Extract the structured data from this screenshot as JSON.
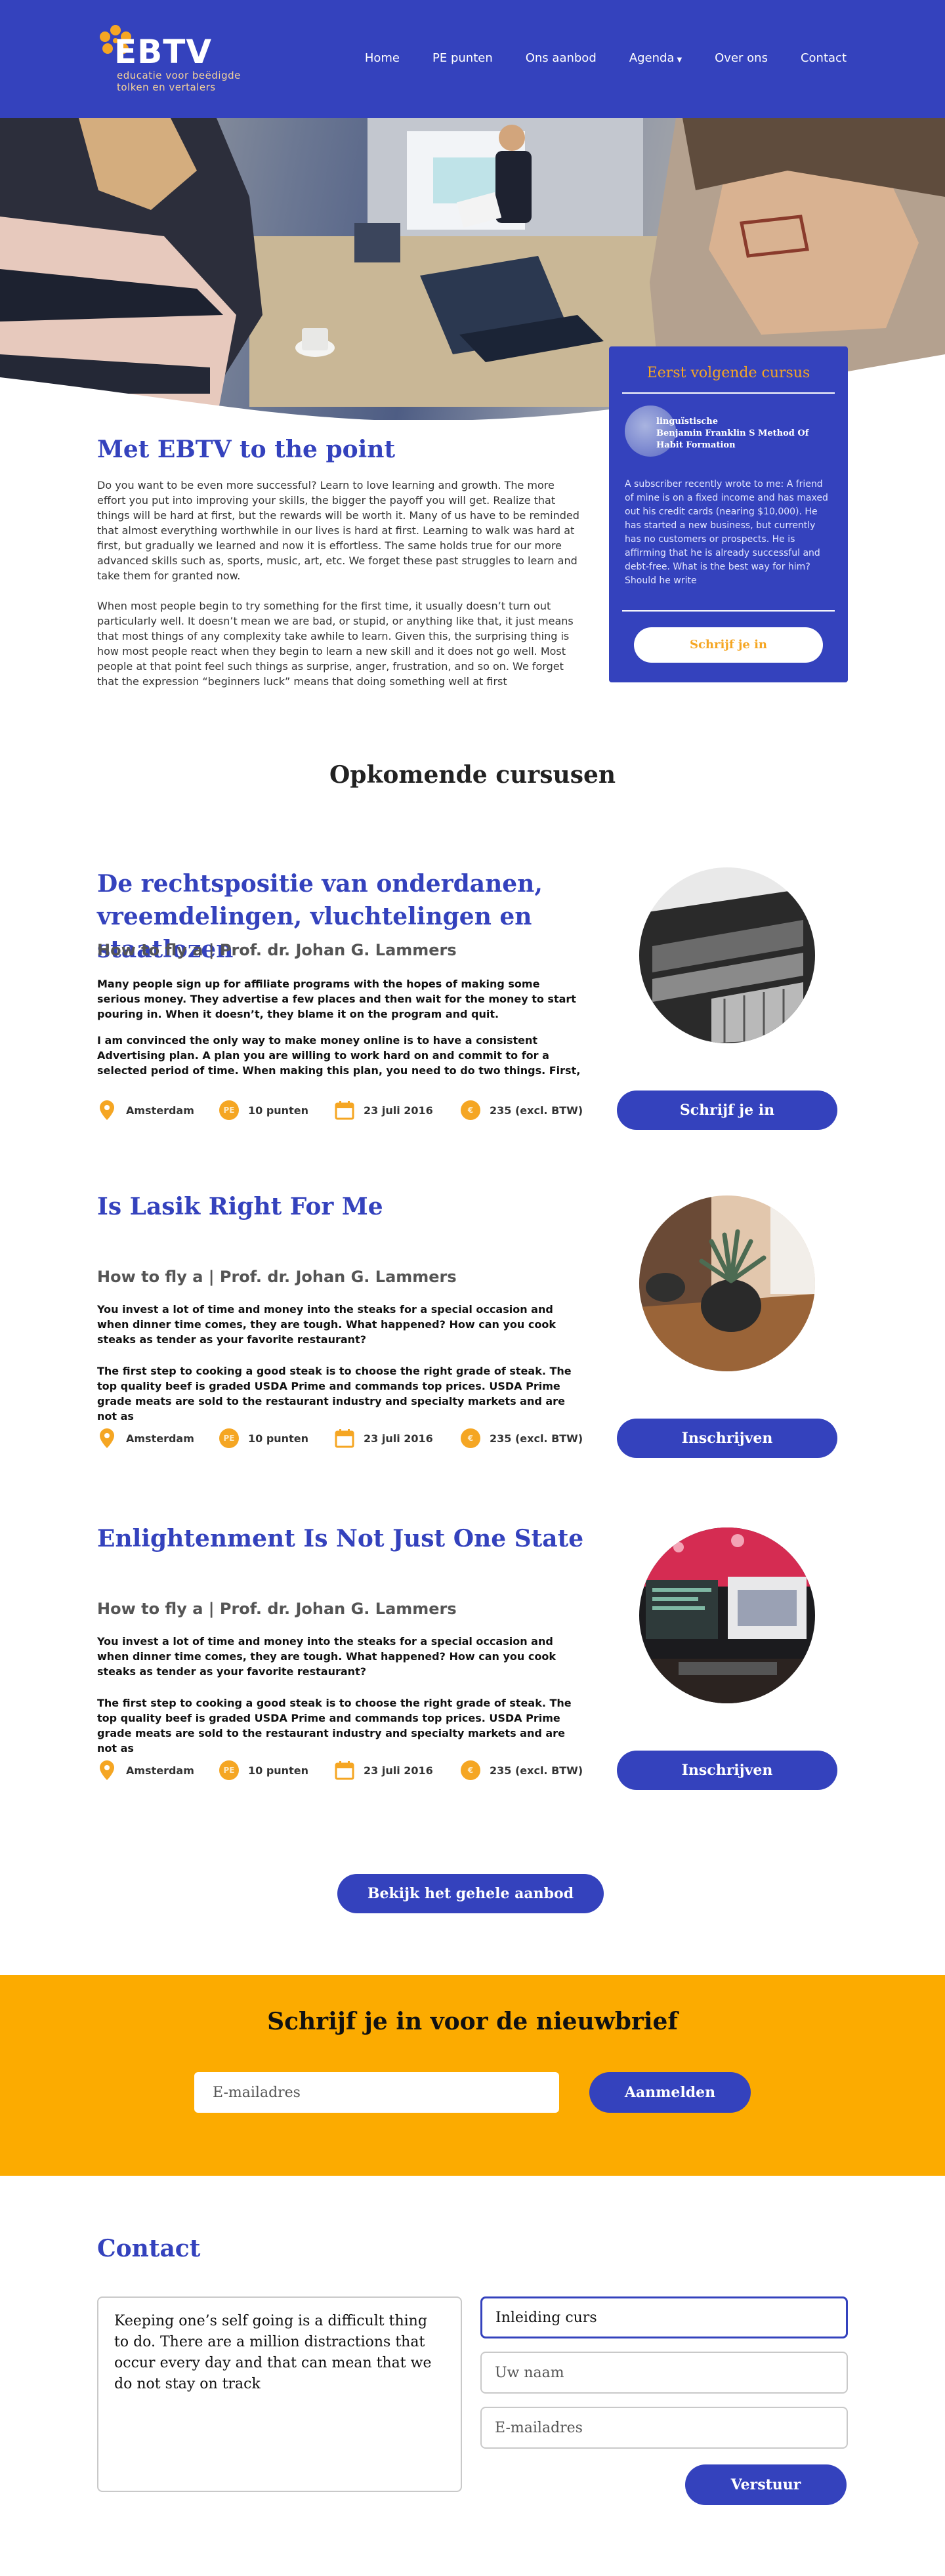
{
  "header": {
    "logo_text": "EBTV",
    "logo_tagline_1": "educatie voor beëdigde",
    "logo_tagline_2": "tolken en vertalers",
    "nav": [
      {
        "label": "Home"
      },
      {
        "label": "PE punten"
      },
      {
        "label": "Ons aanbod"
      },
      {
        "label": "Agenda"
      },
      {
        "label": "Over ons"
      },
      {
        "label": "Contact"
      }
    ]
  },
  "next_course": {
    "title": "Eerst volgende cursus",
    "subtitle_1": "linguïstische",
    "subtitle_2": "Benjamin Franklin S Method Of",
    "subtitle_3": "Habit Formation",
    "body": "A subscriber recently wrote to me: A friend of mine is on a fixed income and has maxed out his credit cards (nearing $10,000). He has started a new business, but currently has no customers or prospects. He is affirming that he is already successful and debt-free. What is the best way for him? Should he write",
    "button": "Schrijf je in"
  },
  "intro": {
    "title": "Met EBTV to the point",
    "p1": "Do you want to be even more successful? Learn to love learning and growth. The more effort you put into improving your skills, the bigger the payoff you will get. Realize that things will be hard at first, but the rewards will be worth it. Many of us have to be reminded that almost everything worthwhile in our lives is hard at first. Learning to walk was hard at first, but gradually we learned and now it is effortless. The same holds true for our more advanced skills such as, sports, music, art, etc. We forget these past struggles to learn and take them for granted now.",
    "p2": "When most people begin to try something for the first time, it usually doesn’t turn out particularly well. It doesn’t mean we are bad, or stupid, or anything like that, it just means that most things of any complexity take awhile to learn. Given this, the surprising thing is how most people react when they begin to learn a new skill and it does not go well. Most people at that point feel such things as surprise, anger, frustration, and so on. We forget that the expression “beginners luck” means that doing something well at first"
  },
  "upcoming": {
    "title": "Opkomende cursusen",
    "courses": [
      {
        "title": "De rechtspositie van onderdanen, vreemdelingen, vluchtelingen en staatlozen",
        "subtitle": "How to fly a | Prof. dr. Johan G. Lammers",
        "p1": "Many people sign up for affiliate programs with the hopes of making some serious money. They advertise a few places and then wait for the money to start pouring in. When it doesn’t, they blame it on the program and quit.",
        "p2": "I am convinced the only way to make money online is to have a consistent Advertising plan. A plan you are willing to work hard on and commit to for a selected period of time. When making this plan, you need to do two things.  First,",
        "location": "Amsterdam",
        "points_badge": "PE",
        "points": "10 punten",
        "date": "23 juli 2016",
        "price_badge": "€",
        "price": "235 (excl. BTW)",
        "button": "Schrijf je in"
      },
      {
        "title": "Is Lasik Right For Me",
        "subtitle": "How to fly a | Prof. dr. Johan G. Lammers",
        "p1": "You invest a lot of time and money into the steaks for a special occasion and when dinner time comes, they are tough. What happened? How can you cook steaks as tender as your favorite restaurant?",
        "p2": "The first step to cooking a good steak is to choose the right grade of steak. The top quality beef is graded USDA Prime and commands top prices. USDA Prime grade meats are sold to the restaurant industry and specialty markets and are not as",
        "location": "Amsterdam",
        "points_badge": "PE",
        "points": "10 punten",
        "date": "23 juli 2016",
        "price_badge": "€",
        "price": "235 (excl. BTW)",
        "button": "Inschrijven"
      },
      {
        "title": "Enlightenment Is Not Just One State",
        "subtitle": "How to fly a | Prof. dr. Johan G. Lammers",
        "p1": "You invest a lot of time and money into the steaks for a special occasion and when dinner time comes, they are tough. What happened? How can you cook steaks as tender as your favorite restaurant?",
        "p2": "The first step to cooking a good steak is to choose the right grade of steak. The top quality beef is graded USDA Prime and commands top prices. USDA Prime grade meats are sold to the restaurant industry and specialty markets and are not as",
        "location": "Amsterdam",
        "points_badge": "PE",
        "points": "10 punten",
        "date": "23 juli 2016",
        "price_badge": "€",
        "price": "235 (excl. BTW)",
        "button": "Inschrijven"
      }
    ],
    "all_button": "Bekijk het gehele aanbod"
  },
  "newsletter": {
    "title": "Schrijf je in voor de nieuwbrief",
    "email_placeholder": "E-mailadres",
    "button": "Aanmelden"
  },
  "contact": {
    "title": "Contact",
    "message": "Keeping one’s self going is a difficult thing to do. There are a million distractions that occur every day and that can mean that we do not stay on track",
    "subject_value": "Inleiding curs",
    "name_placeholder": "Uw naam",
    "email_placeholder": "E-mailadres",
    "button": "Verstuur"
  },
  "colors": {
    "primary": "#3442bd",
    "accent": "#f5a623",
    "newsletter_bg": "#fcab00"
  },
  "icons": {
    "location": "map-pin-icon",
    "points": "pe-badge-icon",
    "date": "calendar-icon",
    "price": "euro-badge-icon",
    "agenda_caret": "caret-down-icon"
  }
}
